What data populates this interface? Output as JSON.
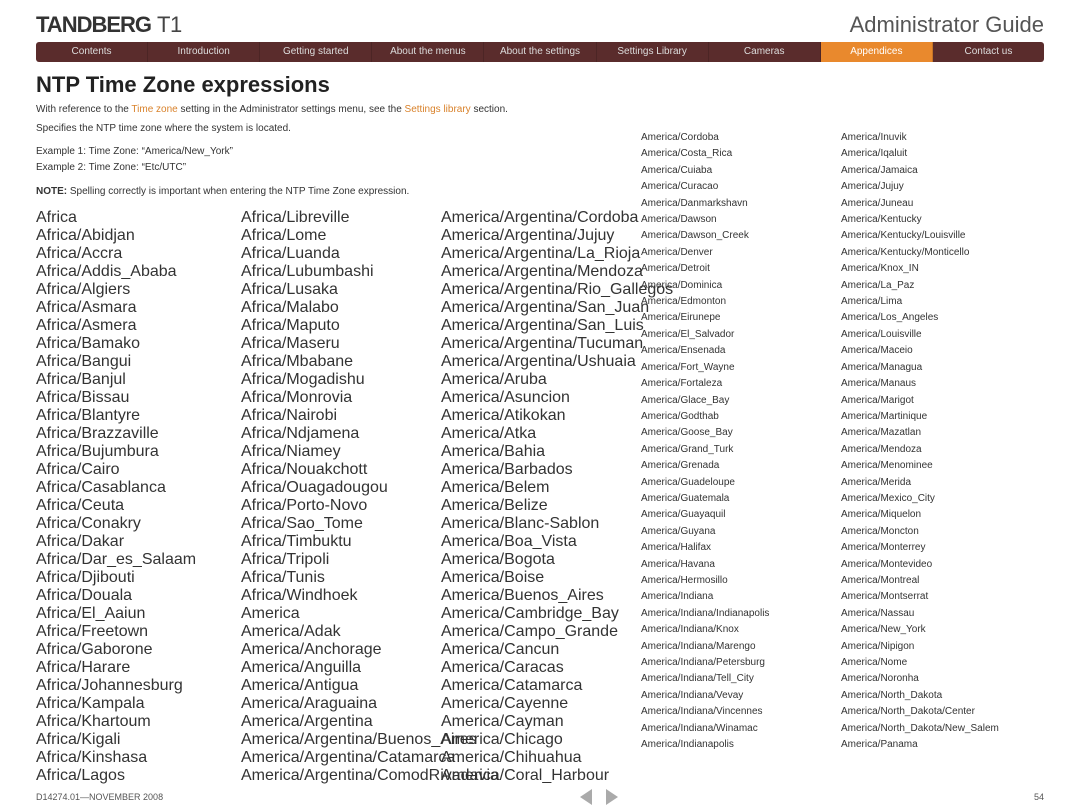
{
  "brand_bold": "TANDBERG",
  "brand_model": "T1",
  "doc_title": "Administrator Guide",
  "nav": [
    "Contents",
    "Introduction",
    "Getting started",
    "About the menus",
    "About the settings",
    "Settings Library",
    "Cameras",
    "Appendices",
    "Contact us"
  ],
  "nav_active_index": 7,
  "page_title": "NTP Time Zone expressions",
  "intro_pre": "With reference to the ",
  "intro_link1": "Time zone",
  "intro_mid": " setting in the Administrator settings menu, see the ",
  "intro_link2": "Settings library",
  "intro_post": " section.",
  "intro_line2": "Specifies the NTP time zone where the system is located.",
  "example1": "Example 1: Time Zone: “America/New_York”",
  "example2": "Example 2: Time Zone: “Etc/UTC”",
  "note_label": "NOTE:",
  "note_text": " Spelling correctly is important when entering the NTP Time Zone expression.",
  "footer_left": "D14274.01—NOVEMBER 2008",
  "page_num": "54",
  "col1": [
    "Africa",
    "Africa/Abidjan",
    "Africa/Accra",
    "Africa/Addis_Ababa",
    "Africa/Algiers",
    "Africa/Asmara",
    "Africa/Asmera",
    "Africa/Bamako",
    "Africa/Bangui",
    "Africa/Banjul",
    "Africa/Bissau",
    "Africa/Blantyre",
    "Africa/Brazzaville",
    "Africa/Bujumbura",
    "Africa/Cairo",
    "Africa/Casablanca",
    "Africa/Ceuta",
    "Africa/Conakry",
    "Africa/Dakar",
    "Africa/Dar_es_Salaam",
    "Africa/Djibouti",
    "Africa/Douala",
    "Africa/El_Aaiun",
    "Africa/Freetown",
    "Africa/Gaborone",
    "Africa/Harare",
    "Africa/Johannesburg",
    "Africa/Kampala",
    "Africa/Khartoum",
    "Africa/Kigali",
    "Africa/Kinshasa",
    "Africa/Lagos"
  ],
  "col2": [
    "Africa/Libreville",
    "Africa/Lome",
    "Africa/Luanda",
    "Africa/Lubumbashi",
    "Africa/Lusaka",
    "Africa/Malabo",
    "Africa/Maputo",
    "Africa/Maseru",
    "Africa/Mbabane",
    "Africa/Mogadishu",
    "Africa/Monrovia",
    "Africa/Nairobi",
    "Africa/Ndjamena",
    "Africa/Niamey",
    "Africa/Nouakchott",
    "Africa/Ouagadougou",
    "Africa/Porto-Novo",
    "Africa/Sao_Tome",
    "Africa/Timbuktu",
    "Africa/Tripoli",
    "Africa/Tunis",
    "Africa/Windhoek",
    "America",
    "America/Adak",
    "America/Anchorage",
    "America/Anguilla",
    "America/Antigua",
    "America/Araguaina",
    "America/Argentina",
    "America/Argentina/Buenos_Aires",
    "America/Argentina/Catamarca",
    "America/Argentina/ComodRivadavia"
  ],
  "col3": [
    "America/Argentina/Cordoba",
    "America/Argentina/Jujuy",
    "America/Argentina/La_Rioja",
    "America/Argentina/Mendoza",
    "America/Argentina/Rio_Gallegos",
    "America/Argentina/San_Juan",
    "America/Argentina/San_Luis",
    "America/Argentina/Tucuman",
    "America/Argentina/Ushuaia",
    "America/Aruba",
    "America/Asuncion",
    "America/Atikokan",
    "America/Atka",
    "America/Bahia",
    "America/Barbados",
    "America/Belem",
    "America/Belize",
    "America/Blanc-Sablon",
    "America/Boa_Vista",
    "America/Bogota",
    "America/Boise",
    "America/Buenos_Aires",
    "America/Cambridge_Bay",
    "America/Campo_Grande",
    "America/Cancun",
    "America/Caracas",
    "America/Catamarca",
    "America/Cayenne",
    "America/Cayman",
    "America/Chicago",
    "America/Chihuahua",
    "America/Coral_Harbour"
  ],
  "col4": [
    "America/Cordoba",
    "America/Costa_Rica",
    "America/Cuiaba",
    "America/Curacao",
    "America/Danmarkshavn",
    "America/Dawson",
    "America/Dawson_Creek",
    "America/Denver",
    "America/Detroit",
    "America/Dominica",
    "America/Edmonton",
    "America/Eirunepe",
    "America/El_Salvador",
    "America/Ensenada",
    "America/Fort_Wayne",
    "America/Fortaleza",
    "America/Glace_Bay",
    "America/Godthab",
    "America/Goose_Bay",
    "America/Grand_Turk",
    "America/Grenada",
    "America/Guadeloupe",
    "America/Guatemala",
    "America/Guayaquil",
    "America/Guyana",
    "America/Halifax",
    "America/Havana",
    "America/Hermosillo",
    "America/Indiana",
    "America/Indiana/Indianapolis",
    "America/Indiana/Knox",
    "America/Indiana/Marengo",
    "America/Indiana/Petersburg",
    "America/Indiana/Tell_City",
    "America/Indiana/Vevay",
    "America/Indiana/Vincennes",
    "America/Indiana/Winamac",
    "America/Indianapolis"
  ],
  "col5": [
    "America/Inuvik",
    "America/Iqaluit",
    "America/Jamaica",
    "America/Jujuy",
    "America/Juneau",
    "America/Kentucky",
    "America/Kentucky/Louisville",
    "America/Kentucky/Monticello",
    "America/Knox_IN",
    "America/La_Paz",
    "America/Lima",
    "America/Los_Angeles",
    "America/Louisville",
    "America/Maceio",
    "America/Managua",
    "America/Manaus",
    "America/Marigot",
    "America/Martinique",
    "America/Mazatlan",
    "America/Mendoza",
    "America/Menominee",
    "America/Merida",
    "America/Mexico_City",
    "America/Miquelon",
    "America/Moncton",
    "America/Monterrey",
    "America/Montevideo",
    "America/Montreal",
    "America/Montserrat",
    "America/Nassau",
    "America/New_York",
    "America/Nipigon",
    "America/Nome",
    "America/Noronha",
    "America/North_Dakota",
    "America/North_Dakota/Center",
    "America/North_Dakota/New_Salem",
    "America/Panama"
  ]
}
